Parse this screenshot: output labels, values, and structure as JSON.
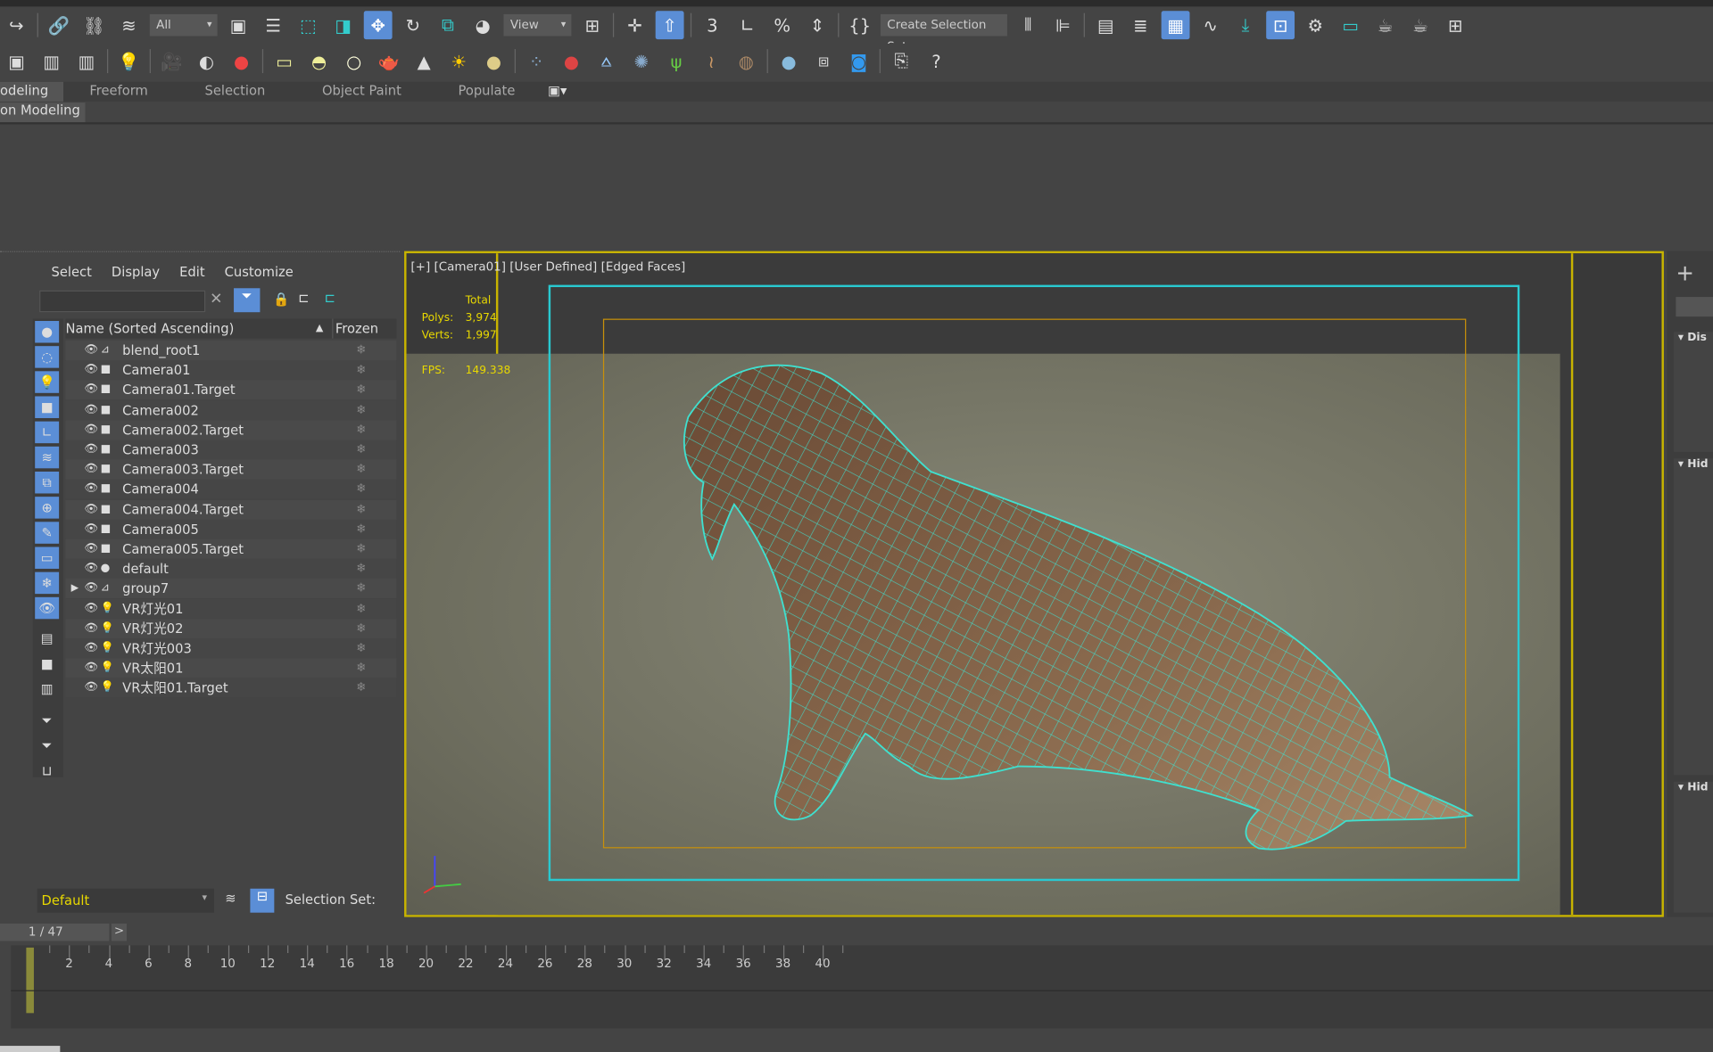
{
  "toolbar": {
    "filter_dropdown": "All",
    "view_dropdown": "View",
    "selection_set": "Create Selection Set"
  },
  "ribbon": {
    "tabs": [
      "odeling",
      "Freeform",
      "Selection",
      "Object Paint",
      "Populate"
    ],
    "subtab": "on Modeling"
  },
  "explorer": {
    "menu": [
      "Select",
      "Display",
      "Edit",
      "Customize"
    ],
    "search_placeholder": "",
    "col_name": "Name (Sorted Ascending)",
    "col_frozen": "Frozen",
    "items": [
      {
        "name": "blend_root1",
        "type": "bone"
      },
      {
        "name": "Camera01",
        "type": "camera"
      },
      {
        "name": "Camera01.Target",
        "type": "camera"
      },
      {
        "name": "Camera002",
        "type": "camera"
      },
      {
        "name": "Camera002.Target",
        "type": "camera"
      },
      {
        "name": "Camera003",
        "type": "camera"
      },
      {
        "name": "Camera003.Target",
        "type": "camera"
      },
      {
        "name": "Camera004",
        "type": "camera"
      },
      {
        "name": "Camera004.Target",
        "type": "camera"
      },
      {
        "name": "Camera005",
        "type": "camera"
      },
      {
        "name": "Camera005.Target",
        "type": "camera"
      },
      {
        "name": "default",
        "type": "geometry"
      },
      {
        "name": "group7",
        "type": "bone",
        "expandable": true
      },
      {
        "name": "VR灯光01",
        "type": "light"
      },
      {
        "name": "VR灯光02",
        "type": "light"
      },
      {
        "name": "VR灯光003",
        "type": "light"
      },
      {
        "name": "VR太阳01",
        "type": "light"
      },
      {
        "name": "VR太阳01.Target",
        "type": "light"
      }
    ],
    "layer": "Default",
    "selection_set_label": "Selection Set:"
  },
  "viewport": {
    "label": "[+] [Camera01] [User Defined] [Edged Faces]",
    "stats_header": "Total",
    "polys_label": "Polys:",
    "polys": "3,974",
    "verts_label": "Verts:",
    "verts": "1,997",
    "fps_label": "FPS:",
    "fps": "149.338"
  },
  "rightpanel": {
    "sections": [
      "Dis",
      "Hid",
      "Hid"
    ]
  },
  "timeline": {
    "frame": "1 / 47",
    "next": ">",
    "ticks": [
      "2",
      "4",
      "6",
      "8",
      "10",
      "12",
      "14",
      "16",
      "18",
      "20",
      "22",
      "24",
      "26",
      "28",
      "30",
      "32",
      "34",
      "36",
      "38",
      "40"
    ]
  },
  "colors": {
    "accent": "#5b8ed6",
    "viewport_border": "#c8b400",
    "safe_frame": "#29c9d0",
    "wire": "#3fe0cf"
  }
}
